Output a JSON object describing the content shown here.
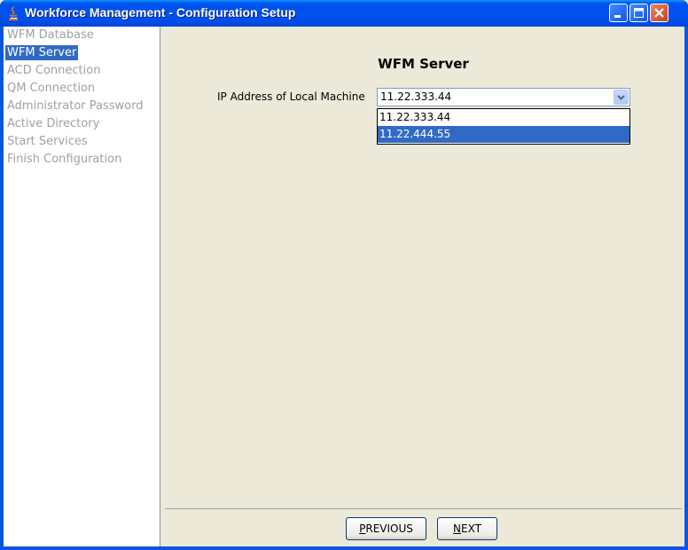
{
  "window": {
    "title": "Workforce Management - Configuration Setup"
  },
  "sidebar": {
    "items": [
      {
        "label": "WFM Database",
        "selected": false
      },
      {
        "label": "WFM Server",
        "selected": true
      },
      {
        "label": "ACD Connection",
        "selected": false
      },
      {
        "label": "QM Connection",
        "selected": false
      },
      {
        "label": "Administrator Password",
        "selected": false
      },
      {
        "label": "Active Directory",
        "selected": false
      },
      {
        "label": "Start Services",
        "selected": false
      },
      {
        "label": "Finish Configuration",
        "selected": false
      }
    ]
  },
  "main": {
    "heading": "WFM Server",
    "ip_label": "IP Address of Local Machine",
    "ip_value": "11.22.333.44",
    "ip_options": [
      "11.22.333.44",
      "11.22.444.55"
    ],
    "highlighted_option": "11.22.444.55"
  },
  "footer": {
    "previous_first": "P",
    "previous_rest": "REVIOUS",
    "next_first": "N",
    "next_rest": "EXT"
  },
  "colors": {
    "selection": "#316AC5",
    "titlebar": "#0053EE",
    "background": "#ECE9D8"
  }
}
